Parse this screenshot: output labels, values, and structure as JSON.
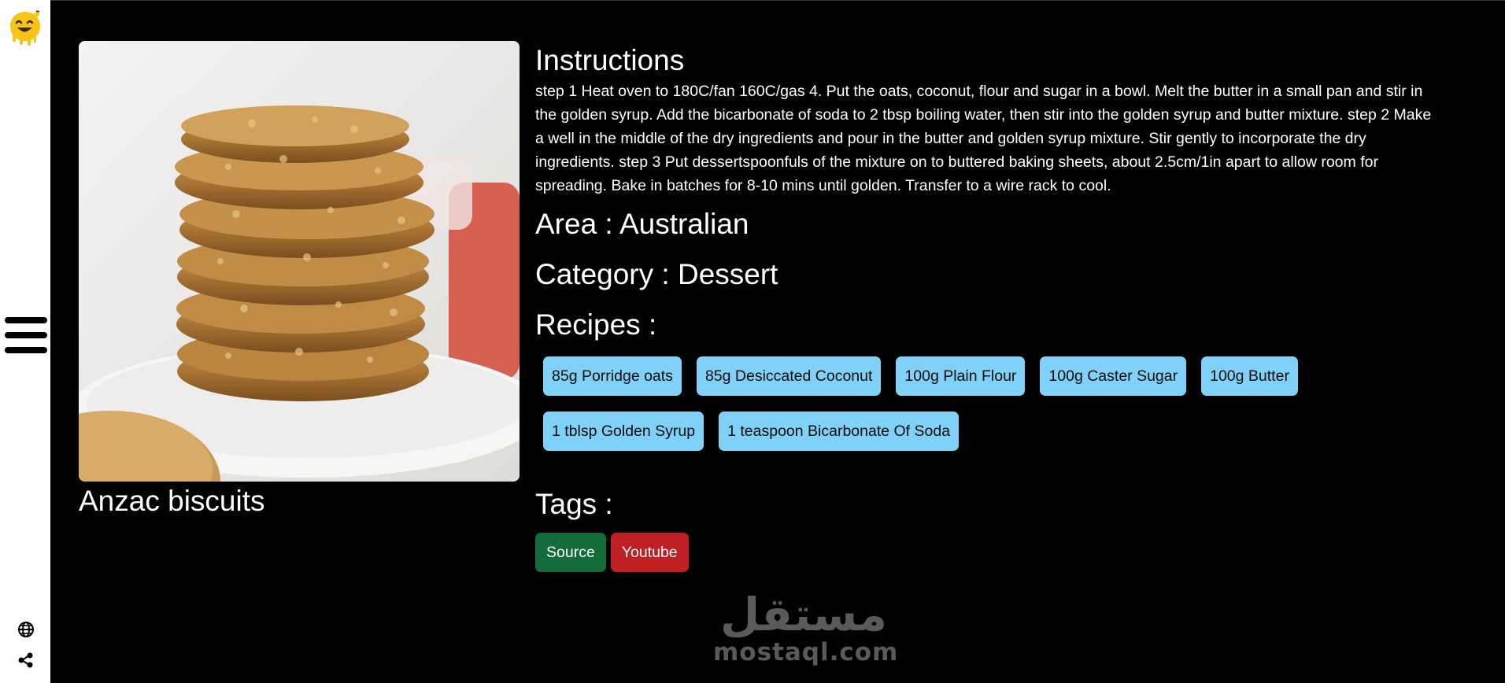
{
  "sidebar": {
    "logo_icon": "smiling-face-logo",
    "menu_icon": "hamburger-menu-icon",
    "bottom_icons": [
      "globe-icon",
      "share-icon"
    ]
  },
  "meal": {
    "name": "Anzac biscuits",
    "image_subject": "stack of oat biscuits on a plate"
  },
  "instructions": {
    "title": "Instructions",
    "text": "step 1 Heat oven to 180C/fan 160C/gas 4. Put the oats, coconut, flour and sugar in a bowl. Melt the butter in a small pan and stir in the golden syrup. Add the bicarbonate of soda to 2 tbsp boiling water, then stir into the golden syrup and butter mixture. step 2 Make a well in the middle of the dry ingredients and pour in the butter and golden syrup mixture. Stir gently to incorporate the dry ingredients. step 3 Put dessertspoonfuls of the mixture on to buttered baking sheets, about 2.5cm/1in apart to allow room for spreading. Bake in batches for 8-10 mins until golden. Transfer to a wire rack to cool."
  },
  "area": {
    "label": "Area : Australian"
  },
  "category": {
    "label": "Category : Dessert"
  },
  "recipes": {
    "title": "Recipes :",
    "items": [
      "85g Porridge oats",
      "85g Desiccated Coconut",
      "100g Plain Flour",
      "100g Caster Sugar",
      "100g Butter",
      "1 tblsp Golden Syrup",
      "1 teaspoon Bicarbonate Of Soda"
    ]
  },
  "tags": {
    "title": "Tags :",
    "source_label": "Source",
    "youtube_label": "Youtube"
  },
  "colors": {
    "pill": "#7fd1f8",
    "source": "#146c3a",
    "youtube": "#c02024"
  },
  "watermark": {
    "arabic": "مستقل",
    "latin": "mostaql.com"
  }
}
